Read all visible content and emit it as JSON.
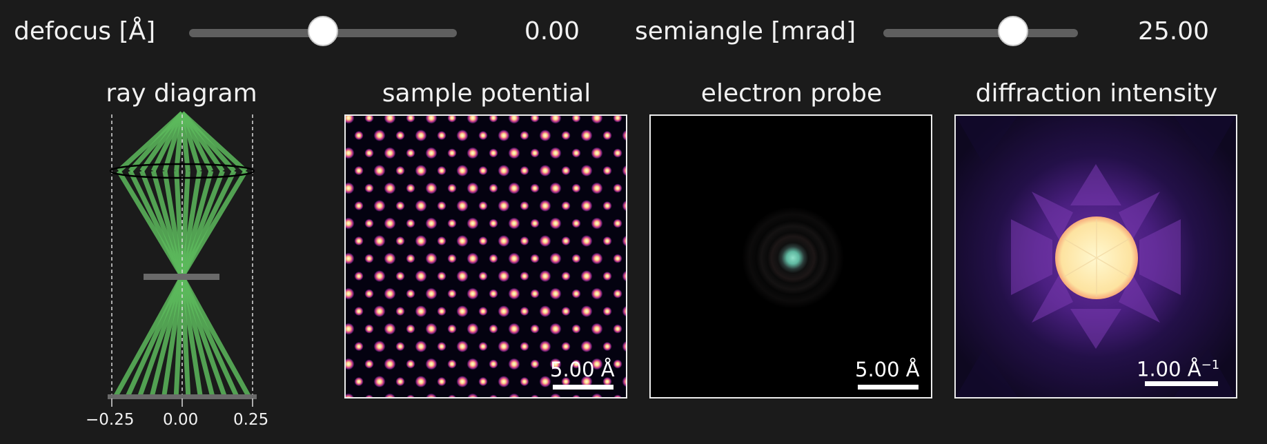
{
  "controls": {
    "defocus": {
      "label": "defocus [Å]",
      "value_text": "0.00",
      "value": 0.0
    },
    "semiangle": {
      "label": "semiangle [mrad]",
      "value_text": "25.00",
      "value": 25.0
    }
  },
  "panels": {
    "ray_diagram": {
      "title": "ray diagram",
      "ticks": [
        "−0.25",
        "0.00",
        "0.25"
      ],
      "beam_color": "#5cb85c"
    },
    "sample_potential": {
      "title": "sample potential",
      "scalebar": "5.00 Å"
    },
    "electron_probe": {
      "title": "electron probe",
      "scalebar": "5.00 Å"
    },
    "diffraction_intensity": {
      "title": "diffraction intensity",
      "scalebar": "1.00 Å",
      "scalebar_sup": "−1"
    }
  },
  "colors": {
    "background": "#1b1b1b",
    "panel_border": "#eeeeee",
    "slider_track": "#5f5f5f",
    "magma_bright": "#fcf7b8",
    "magma_purple": "#5a2a8a",
    "probe_center": "#6fc8b0"
  }
}
